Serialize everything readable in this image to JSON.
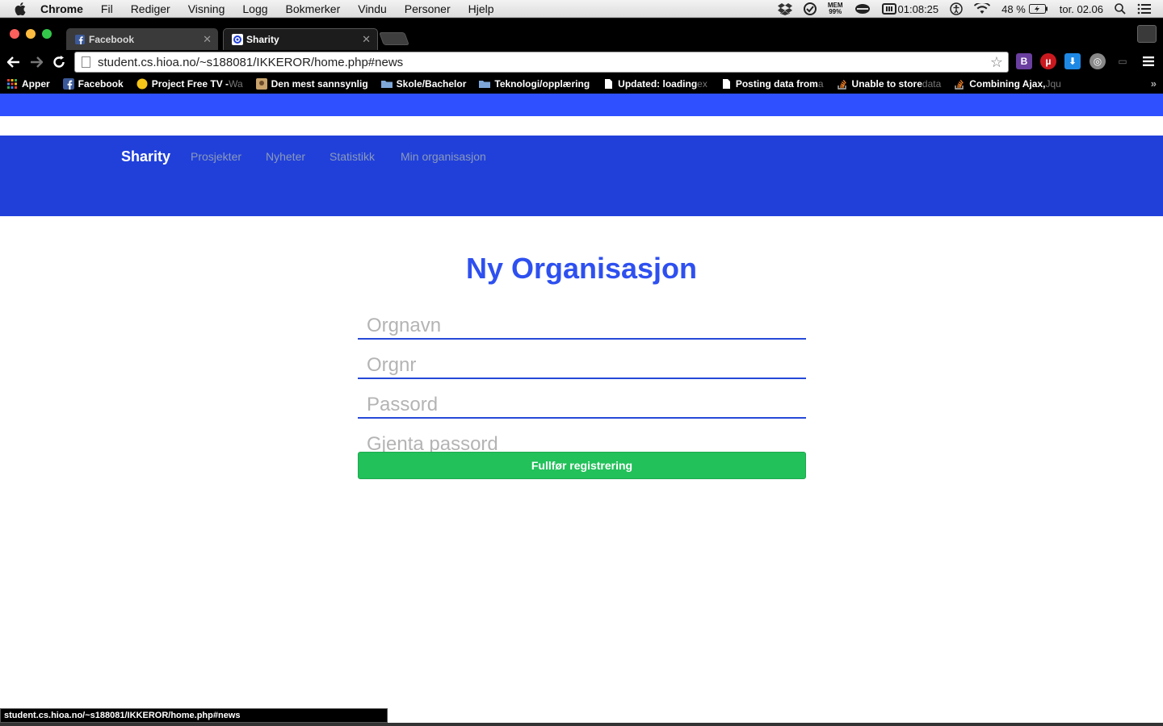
{
  "menubar": {
    "app": "Chrome",
    "items": [
      "Fil",
      "Rediger",
      "Visning",
      "Logg",
      "Bokmerker",
      "Vindu",
      "Personer",
      "Hjelp"
    ],
    "mem_label": "MEM",
    "mem_value": "99%",
    "clock": "01:08:25",
    "battery": "48 %",
    "date": "tor. 02.06"
  },
  "tabs": [
    {
      "title": "Facebook",
      "favicon": "facebook-icon",
      "active": false
    },
    {
      "title": "Sharity",
      "favicon": "sharity-icon",
      "active": true
    }
  ],
  "toolbar": {
    "url": "student.cs.hioa.no/~s188081/IKKEROR/home.php#news"
  },
  "bookmarks": [
    {
      "label": "Apper",
      "faded": "",
      "icon": "apps-grid-icon"
    },
    {
      "label": "Facebook",
      "faded": "",
      "icon": "facebook-icon"
    },
    {
      "label": "Project Free TV - ",
      "faded": "Wa",
      "icon": "tv-icon"
    },
    {
      "label": "Den mest sannsynlig",
      "faded": "",
      "icon": "image-icon"
    },
    {
      "label": "Skole/Bachelor",
      "faded": "",
      "icon": "folder-icon"
    },
    {
      "label": "Teknologi/opplæring",
      "faded": "",
      "icon": "folder-icon"
    },
    {
      "label": "Updated: loading ",
      "faded": "ex",
      "icon": "page-icon"
    },
    {
      "label": "Posting data from ",
      "faded": "a",
      "icon": "page-icon"
    },
    {
      "label": "Unable to store ",
      "faded": "data",
      "icon": "stackoverflow-icon"
    },
    {
      "label": "Combining Ajax, ",
      "faded": "Jqu",
      "icon": "stackoverflow-icon"
    }
  ],
  "site": {
    "brand": "Sharity",
    "nav": [
      "Prosjekter",
      "Nyheter",
      "Statistikk",
      "Min organisasjon"
    ]
  },
  "form": {
    "title": "Ny Organisasjon",
    "fields": [
      {
        "placeholder": "Orgnavn"
      },
      {
        "placeholder": "Orgnr"
      },
      {
        "placeholder": "Passord"
      },
      {
        "placeholder": "Gjenta passord"
      }
    ],
    "submit_label": "Fullfør registrering"
  },
  "statusbar": {
    "text": "student.cs.hioa.no/~s188081/IKKEROR/home.php#news"
  },
  "colors": {
    "accent": "#2e50ff",
    "navbar": "#2140da",
    "submit": "#22c15a"
  }
}
